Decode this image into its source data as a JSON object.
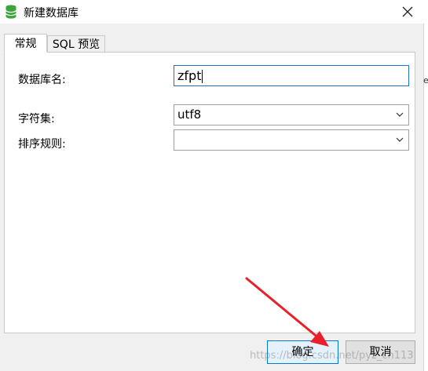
{
  "window": {
    "title": "新建数据库"
  },
  "tabs": [
    {
      "label": "常规",
      "active": true
    },
    {
      "label": "SQL 预览",
      "active": false
    }
  ],
  "form": {
    "db_name_label": "数据库名:",
    "db_name_value": "zfpt",
    "charset_label": "字符集:",
    "charset_value": "utf8",
    "collation_label": "排序规则:",
    "collation_value": ""
  },
  "buttons": {
    "ok": "确定",
    "cancel": "取消"
  },
  "watermark": "https://blog.csdn.net/pyz_cn113",
  "side_edge_text": "e",
  "colors": {
    "accent": "#0078d7",
    "annotation_arrow": "#e8202a",
    "db_icon": "#3aa53a"
  }
}
